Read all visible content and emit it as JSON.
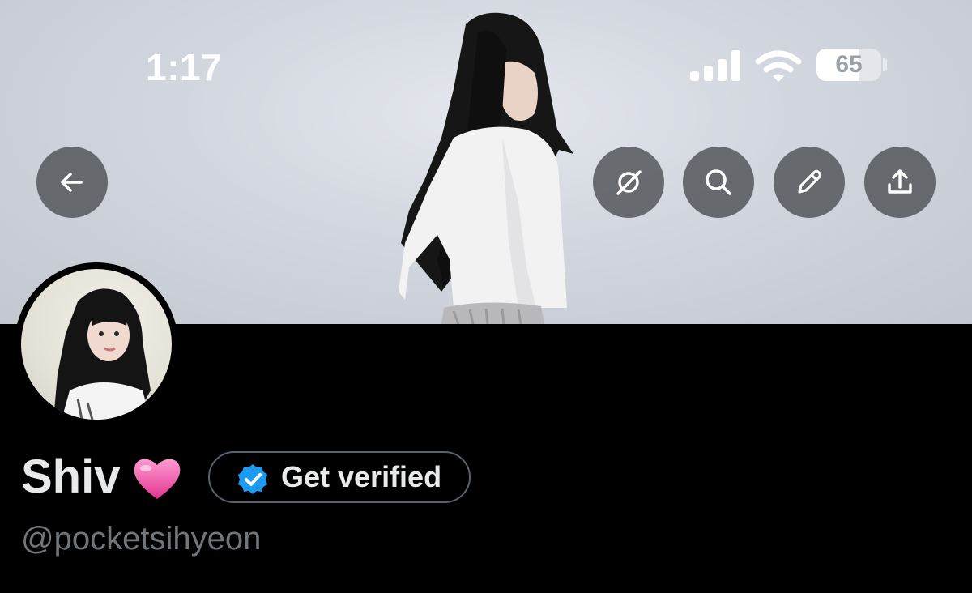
{
  "status_bar": {
    "time": "1:17",
    "battery_level": "65",
    "signal-icon": "cellular-signal-icon",
    "wifi-icon": "wifi-icon"
  },
  "header": {
    "back_icon": "arrow-left-icon",
    "actions": [
      {
        "name": "grok-icon"
      },
      {
        "name": "search-icon"
      },
      {
        "name": "edit-pencil-icon"
      },
      {
        "name": "share-icon"
      }
    ]
  },
  "profile": {
    "display_name": "Shiv",
    "name_emoji": "pink-heart-icon",
    "verify_label": "Get verified",
    "handle": "@pocketsihyeon"
  },
  "colors": {
    "background": "#000000",
    "button_bg": "#484b50",
    "verified_blue": "#1d9bf0",
    "handle_gray": "#71767b",
    "text": "#e7e9ea"
  }
}
